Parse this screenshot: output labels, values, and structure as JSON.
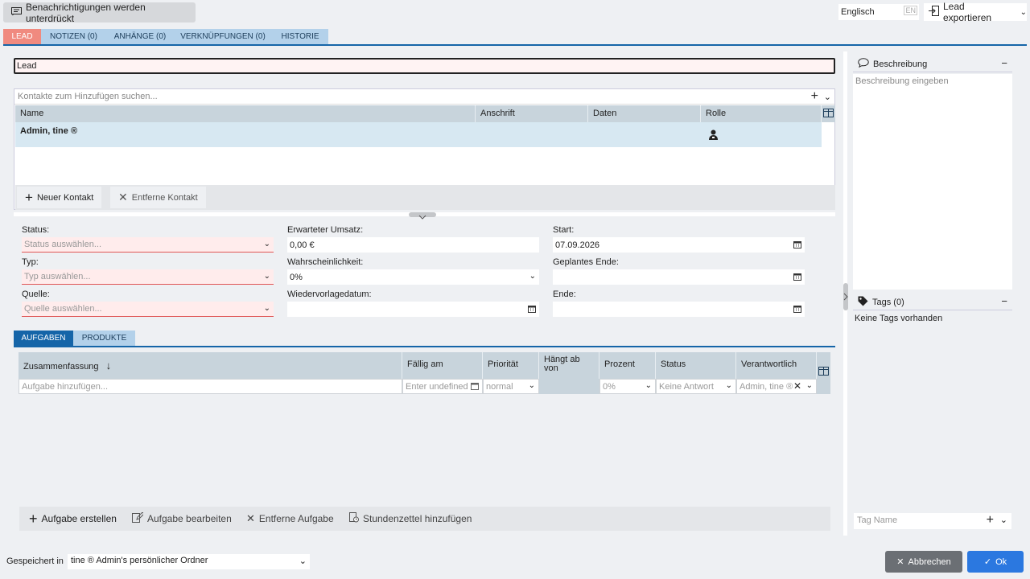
{
  "topbar": {
    "notifications_label": "Benachrichtigungen werden unterdrückt",
    "language_value": "Englisch",
    "language_code": "EN",
    "export_label": "Lead exportieren"
  },
  "tabs": [
    {
      "label": "LEAD",
      "active": true
    },
    {
      "label": "NOTIZEN (0)"
    },
    {
      "label": "ANHÄNGE (0)"
    },
    {
      "label": "VERKNÜPFUNGEN (0)"
    },
    {
      "label": "HISTORIE"
    }
  ],
  "lead_title": "Lead",
  "contacts": {
    "search_placeholder": "Kontakte zum Hinzufügen suchen...",
    "columns": [
      "Name",
      "Anschrift",
      "Daten",
      "Rolle"
    ],
    "rows": [
      {
        "name": "Admin, tine ®"
      }
    ],
    "new_contact_label": "Neuer Kontakt",
    "remove_contact_label": "Entferne Kontakt"
  },
  "form": {
    "status_label": "Status:",
    "status_placeholder": "Status auswählen...",
    "type_label": "Typ:",
    "type_placeholder": "Typ auswählen...",
    "source_label": "Quelle:",
    "source_placeholder": "Quelle auswählen...",
    "revenue_label": "Erwarteter Umsatz:",
    "revenue_value": "0,00 €",
    "probability_label": "Wahrscheinlichkeit:",
    "probability_value": "0%",
    "resubmission_label": "Wiedervorlagedatum:",
    "resubmission_value": "",
    "start_label": "Start:",
    "start_value": "07.09.2026",
    "planned_end_label": "Geplantes Ende:",
    "planned_end_value": "",
    "end_label": "Ende:",
    "end_value": ""
  },
  "subtabs": [
    {
      "label": "AUFGABEN",
      "active": true
    },
    {
      "label": "PRODUKTE"
    }
  ],
  "tasks": {
    "columns": [
      "Zusammenfassung",
      "Fällig am",
      "Priorität",
      "Hängt ab von",
      "Prozent",
      "Status",
      "Verantwortlich"
    ],
    "new_task_placeholder": "Aufgabe hinzufügen...",
    "due_placeholder": "Enter undefined",
    "priority_value": "normal",
    "percent_value": "0%",
    "status_value": "Keine Antwort",
    "responsible_value": "Admin, tine ®",
    "create_label": "Aufgabe erstellen",
    "edit_label": "Aufgabe bearbeiten",
    "remove_label": "Entferne Aufgabe",
    "timesheet_label": "Stundenzettel hinzufügen"
  },
  "sidebar": {
    "description_title": "Beschreibung",
    "description_placeholder": "Beschreibung eingeben",
    "tags_title": "Tags (0)",
    "tags_empty": "Keine Tags vorhanden",
    "tag_placeholder": "Tag Name"
  },
  "bottom": {
    "saved_in_label": "Gespeichert in",
    "folder_value": "tine ® Admin's persönlicher Ordner",
    "cancel_label": "Abbrechen",
    "ok_label": "Ok"
  },
  "colors": {
    "accent_blue": "#1565a8",
    "lead_tab": "#f08a7f",
    "ok_button": "#2b78e0",
    "cancel_button": "#6b6f74"
  }
}
